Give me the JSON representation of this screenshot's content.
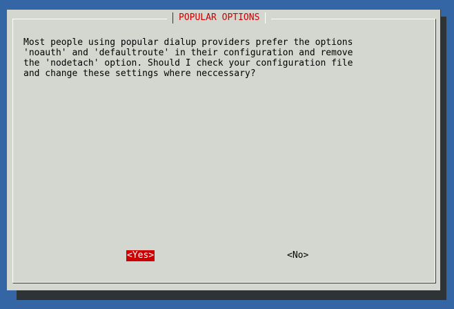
{
  "dialog": {
    "title": "POPULAR OPTIONS",
    "message": "Most people using popular dialup providers prefer the options\n'noauth' and 'defaultroute' in their configuration and remove\nthe 'nodetach' option. Should I check your configuration file\nand change these settings where neccessary?",
    "buttons": {
      "yes_label": "<Yes>",
      "no_label": "<No>"
    },
    "selected_button": "yes"
  },
  "colors": {
    "screen_background": "#3465a4",
    "dialog_background": "#d3d7cf",
    "title_text": "#cc0000",
    "selected_button_background": "#cc0000",
    "shadow": "#2e3436"
  }
}
